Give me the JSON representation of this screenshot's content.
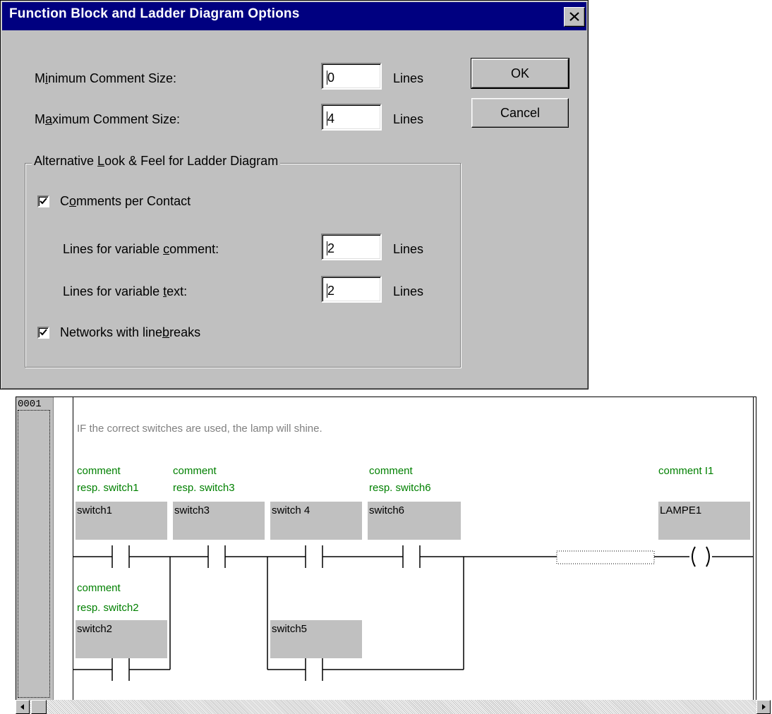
{
  "dialog": {
    "title": "Function Block and Ladder Diagram Options",
    "min_comment": {
      "label_pre": "M",
      "label_ul": "i",
      "label_post": "nimum Comment Size:",
      "value": "0",
      "unit": "Lines"
    },
    "max_comment": {
      "label_pre": "M",
      "label_ul": "a",
      "label_post": "ximum Comment Size:",
      "value": "4",
      "unit": "Lines"
    },
    "ok_label": "OK",
    "cancel_label": "Cancel",
    "group": {
      "legend_pre": "Alternative ",
      "legend_ul": "L",
      "legend_post": "ook & Feel for Ladder Diagram",
      "comments_per_contact": {
        "pre": "C",
        "ul": "o",
        "post": "mments per Contact",
        "checked": true
      },
      "var_comment": {
        "pre": "Lines for variable ",
        "ul": "c",
        "post": "omment:",
        "value": "2",
        "unit": "Lines"
      },
      "var_text": {
        "pre": "Lines for variable ",
        "ul": "t",
        "post": "ext:",
        "value": "2",
        "unit": "Lines"
      },
      "linebreaks": {
        "pre": "Networks with line",
        "ul": "b",
        "post": "reaks",
        "checked": true
      }
    }
  },
  "ladder": {
    "network_number": "0001",
    "network_comment": "IF the correct switches are used, the lamp will shine.",
    "contacts": [
      {
        "comment1": "comment",
        "comment2": "resp. switch1",
        "var": "switch1"
      },
      {
        "comment1": "comment",
        "comment2": "resp. switch3",
        "var": "switch3"
      },
      {
        "comment1": "",
        "comment2": "",
        "var": "switch 4"
      },
      {
        "comment1": "comment",
        "comment2": "resp. switch6",
        "var": "switch6"
      },
      {
        "comment1": "comment",
        "comment2": "resp. switch2",
        "var": "switch2"
      },
      {
        "comment1": "",
        "comment2": "",
        "var": "switch5"
      }
    ],
    "coil": {
      "comment": "comment I1",
      "var": "LAMPE1",
      "symbol": "( )"
    }
  },
  "colors": {
    "titlebar": "#000080",
    "comment_green": "#008000",
    "dialog_bg": "#c0c0c0"
  }
}
